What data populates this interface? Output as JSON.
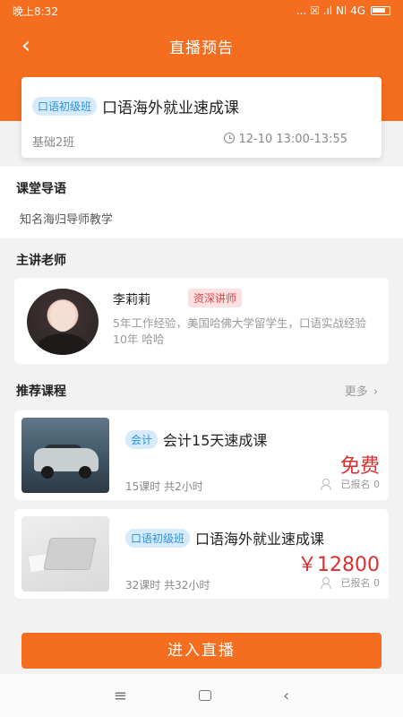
{
  "status_bar": {
    "time": "晚上8:32",
    "icons": "... ☒ .ıl Nl 4G",
    "battery_icon": "battery-icon"
  },
  "nav": {
    "back_icon": "‹",
    "title": "直播预告"
  },
  "live_card": {
    "tag": "口语初级班",
    "title": "口语海外就业速成课",
    "class_name": "基础2班",
    "time": "12-10 13:00-13:55"
  },
  "intro": {
    "heading": "课堂导语",
    "text": "知名海归导师教学"
  },
  "teacher": {
    "heading": "主讲老师",
    "name": "李莉莉",
    "badge": "资深讲师",
    "description": "5年工作经验，美国哈佛大学留学生，口语实战经验10年 哈哈"
  },
  "recommend": {
    "heading": "推荐课程",
    "more_label": "更多",
    "more_icon": "›",
    "courses": [
      {
        "tag": "会计",
        "title": "会计15天速成课",
        "price": "免费",
        "lessons": "15课时 共2小时",
        "enrolled": "已报名 0"
      },
      {
        "tag": "口语初级班",
        "title": "口语海外就业速成课",
        "price": "￥12800",
        "lessons": "32课时 共32小时",
        "enrolled": "已报名 0"
      }
    ]
  },
  "enter_button": "进入直播",
  "system_nav": {
    "menu_icon": "≡",
    "back_icon": "‹"
  },
  "colors": {
    "brand_orange": "#f56d1f",
    "price_red": "#d9302f",
    "tag_blue_bg": "#d6ebfa",
    "tag_blue_text": "#2f8fdc",
    "badge_pink_bg": "#fde0e0",
    "badge_pink_text": "#e0464a"
  }
}
